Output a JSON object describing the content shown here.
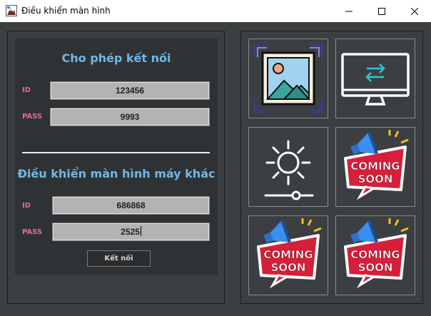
{
  "window": {
    "title": "Điều khiển màn hình"
  },
  "allow_connection": {
    "title": "Cho phép kết nối",
    "id_label": "ID",
    "id_value": "123456",
    "pass_label": "PASS",
    "pass_value": "9993"
  },
  "remote_control": {
    "title": "Điều khiển màn hình máy khác",
    "id_label": "ID",
    "id_value": "686868",
    "pass_label": "PASS",
    "pass_value": "2525",
    "connect_label": "Kết nối"
  },
  "tiles": {
    "coming_soon_line1": "COMING",
    "coming_soon_line2": "SOON"
  },
  "icons": {
    "app": "app-icon",
    "minimize": "minimize-icon",
    "maximize": "maximize-icon",
    "close": "close-icon",
    "image": "image-icon",
    "monitor": "monitor-sync-icon",
    "brightness": "brightness-icon",
    "coming_soon": "megaphone-coming-soon-icon"
  },
  "colors": {
    "panel_bg": "#3c3f41",
    "title_blue": "#6fb8e8",
    "label_pink": "#e86a8a",
    "field_bg": "#b3b3b3"
  }
}
